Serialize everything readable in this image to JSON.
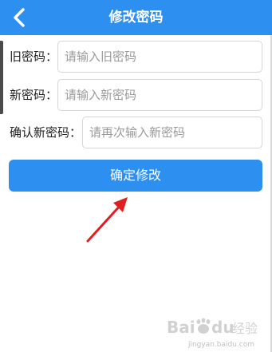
{
  "header": {
    "title": "修改密码",
    "back_icon": "chevron-left-icon"
  },
  "form": {
    "old_password": {
      "label": "旧密码：",
      "placeholder": "请输入旧密码"
    },
    "new_password": {
      "label": "新密码：",
      "placeholder": "请输入新密码"
    },
    "confirm_password": {
      "label": "确认新密码：",
      "placeholder": "请再次输入新密码"
    }
  },
  "submit": {
    "label": "确定修改"
  },
  "watermark": {
    "text": "Baidu经验",
    "sub": "jingyan.baidu.com"
  },
  "colors": {
    "primary": "#2d8ff0",
    "annotation_arrow": "#e02020"
  }
}
